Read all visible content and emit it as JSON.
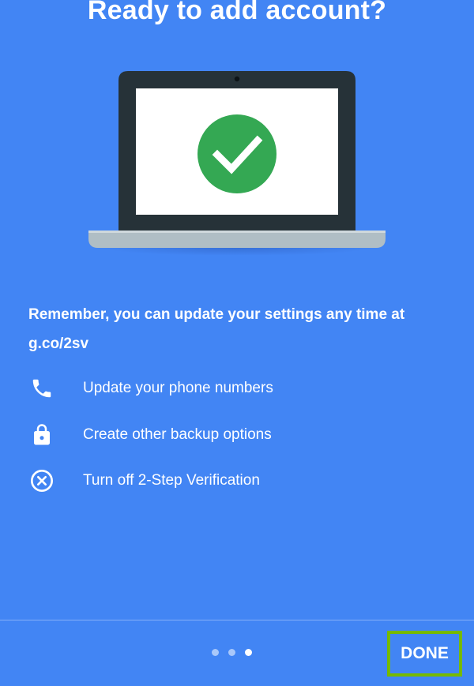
{
  "header": {
    "title": "Ready to add account?"
  },
  "illustration": {
    "icon": "laptop-checkmark-illustration",
    "check_color": "#34a853"
  },
  "message": {
    "remember_text": "Remember, you can update your settings any time at g.co/2sv"
  },
  "options": [
    {
      "icon": "phone-icon",
      "label": "Update your phone numbers"
    },
    {
      "icon": "lock-icon",
      "label": "Create other backup options"
    },
    {
      "icon": "cancel-circle-icon",
      "label": "Turn off 2-Step Verification"
    }
  ],
  "pager": {
    "total": 3,
    "current": 3
  },
  "footer": {
    "done_label": "DONE"
  },
  "colors": {
    "background": "#4285f4",
    "highlight_border": "#76b900"
  }
}
